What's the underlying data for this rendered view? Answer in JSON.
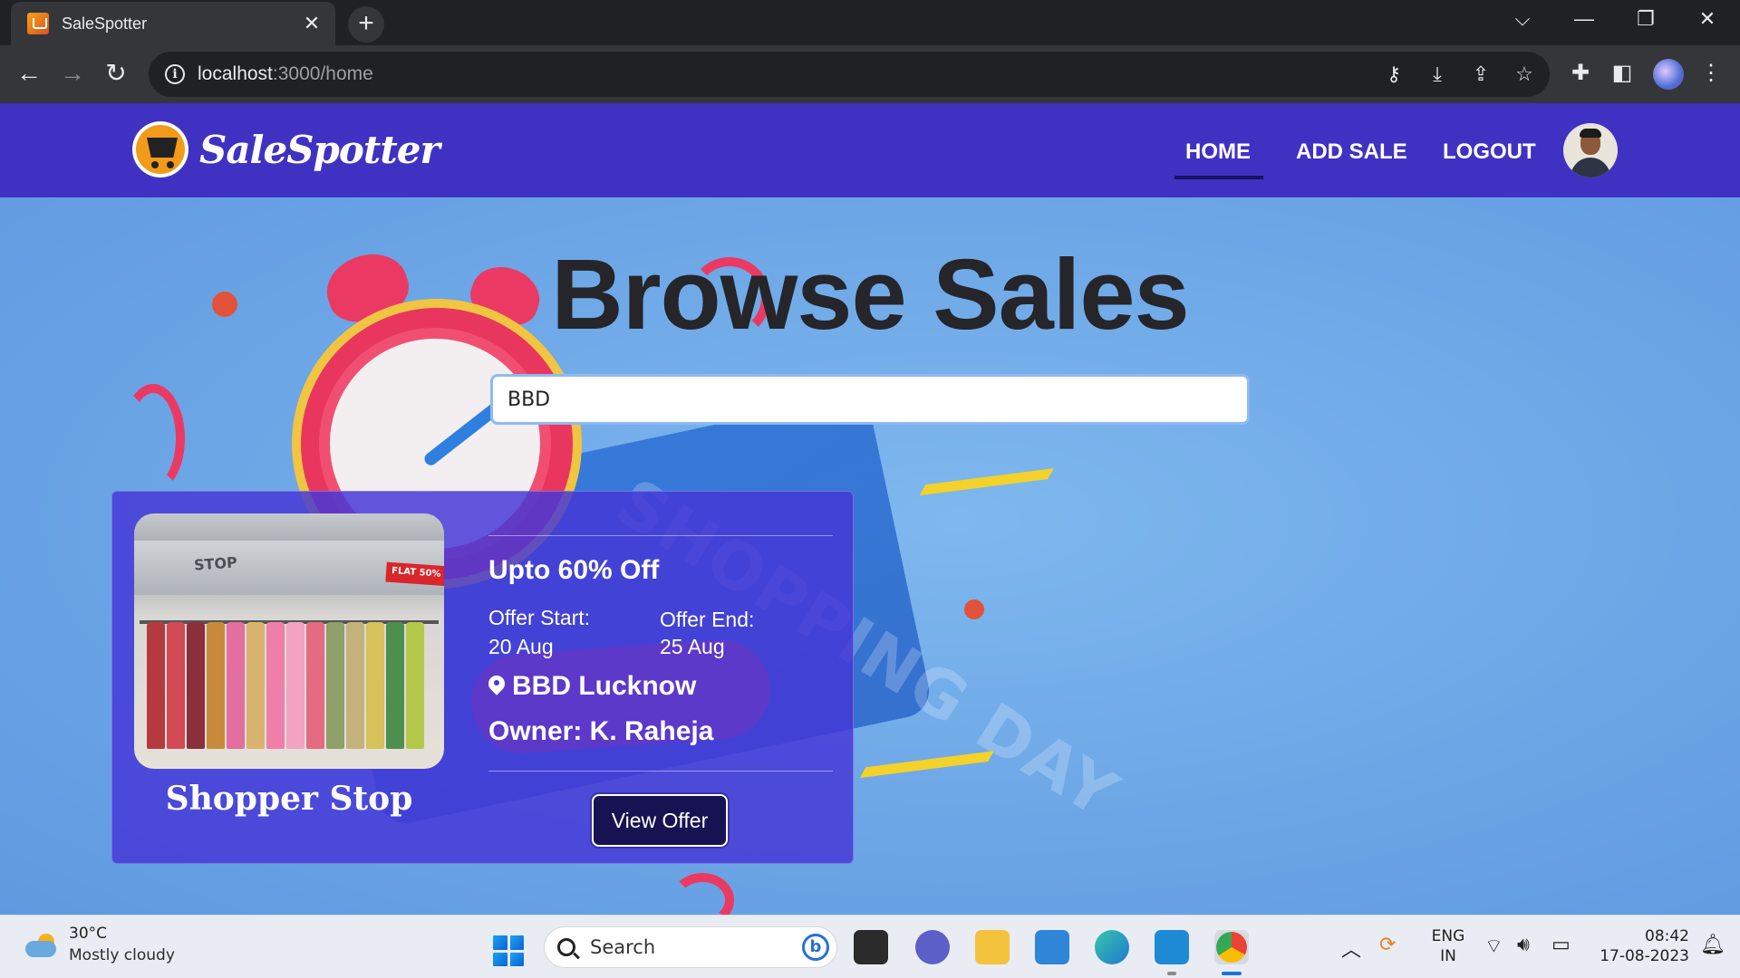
{
  "browser": {
    "tab_title": "SaleSpotter",
    "url_host": "localhost",
    "url_path": ":3000/home"
  },
  "site": {
    "brand": "SaleSpotter",
    "nav": [
      {
        "label": "HOME",
        "active": true
      },
      {
        "label": "ADD SALE",
        "active": false
      },
      {
        "label": "LOGOUT",
        "active": false
      }
    ],
    "accent_color": "#3f32c3"
  },
  "hero": {
    "title": "Browse Sales",
    "search_value": "BBD"
  },
  "sale_card": {
    "store_name": "Shopper Stop",
    "offer": "Upto 60% Off",
    "offer_start_label": "Offer Start:",
    "offer_start": "20 Aug",
    "offer_end_label": "Offer End:",
    "offer_end": "25 Aug",
    "location": "BBD Lucknow",
    "owner": "Owner: K. Raheja",
    "button_label": "View Offer",
    "image_text": {
      "sign": "STOP",
      "tag": "FLAT 50%"
    },
    "background_text": "SHOPPING DAY"
  },
  "taskbar": {
    "weather_temp": "30°C",
    "weather_condition": "Mostly cloudy",
    "search_placeholder": "Search",
    "language_line1": "ENG",
    "language_line2": "IN",
    "time": "08:42",
    "date": "17-08-2023"
  }
}
